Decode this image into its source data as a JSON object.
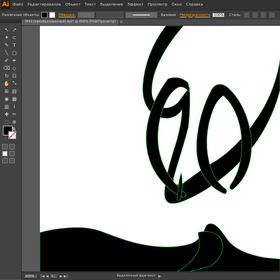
{
  "app": {
    "logo": "Ai"
  },
  "menu": [
    "Файл",
    "Редактирование",
    "Объект",
    "Текст",
    "Выделение",
    "Эффект",
    "Просмотр",
    "Окно",
    "Справка"
  ],
  "control_bar": {
    "left_label": "Различные объекты",
    "stroke_label": "Обводка:",
    "brush_label": "Базовая",
    "opacity_label": "Непрозрачность",
    "opacity_value": "100%",
    "style_label": "Стиль:"
  },
  "document": {
    "tab_title": "3943 [преобразованный].eps* @ 400% (RGB/Просмотр)",
    "close": "×"
  },
  "status": {
    "zoom": "400%",
    "page": "1",
    "message": "Выделенный фрагмент",
    "first": "|◀",
    "prev": "◀",
    "next": "▶",
    "last": "▶|",
    "arrow": "▶"
  },
  "tools": [
    "↖",
    "↗",
    "✦",
    "⊂",
    "✎",
    "T",
    "╲",
    "□",
    "✐",
    "✒",
    "⌫",
    "◇",
    "↻",
    "⊡",
    "✋",
    "⤡",
    "⊞",
    "▤",
    "◉",
    "▦",
    "▥",
    "⌇",
    "✚",
    "✂",
    "⬚",
    "⊕",
    "✋",
    "🔍"
  ],
  "colors": {
    "accent": "#ff9a00",
    "artwork": "#000000",
    "selection": "#2ecc40",
    "canvas": "#ffffff"
  }
}
